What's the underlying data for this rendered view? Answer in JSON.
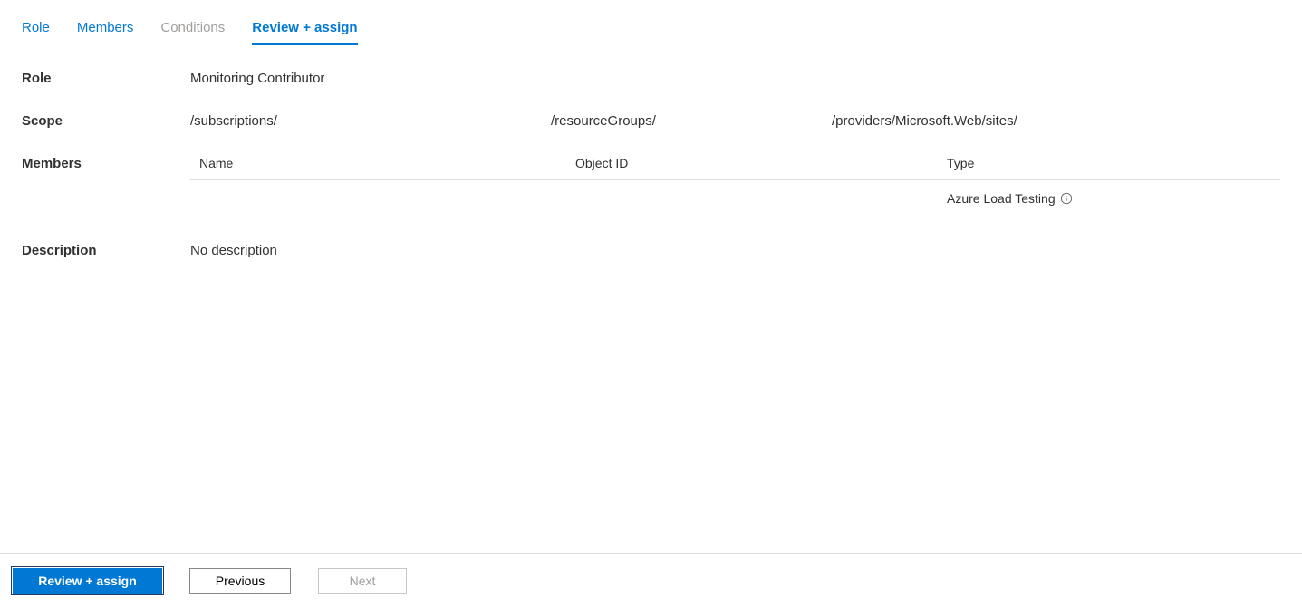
{
  "tabs": {
    "role": "Role",
    "members": "Members",
    "conditions": "Conditions",
    "review": "Review + assign"
  },
  "summary": {
    "role_label": "Role",
    "role_value": "Monitoring Contributor",
    "scope_label": "Scope",
    "scope_seg1": "/subscriptions/",
    "scope_seg2": "/resourceGroups/",
    "scope_seg3": "/providers/Microsoft.Web/sites/",
    "members_label": "Members",
    "desc_label": "Description",
    "desc_value": "No description"
  },
  "members_table": {
    "col_name": "Name",
    "col_objid": "Object ID",
    "col_type": "Type",
    "rows": [
      {
        "name": "",
        "objid": "",
        "type": "Azure Load Testing"
      }
    ]
  },
  "footer": {
    "review_btn": "Review + assign",
    "prev_btn": "Previous",
    "next_btn": "Next"
  }
}
